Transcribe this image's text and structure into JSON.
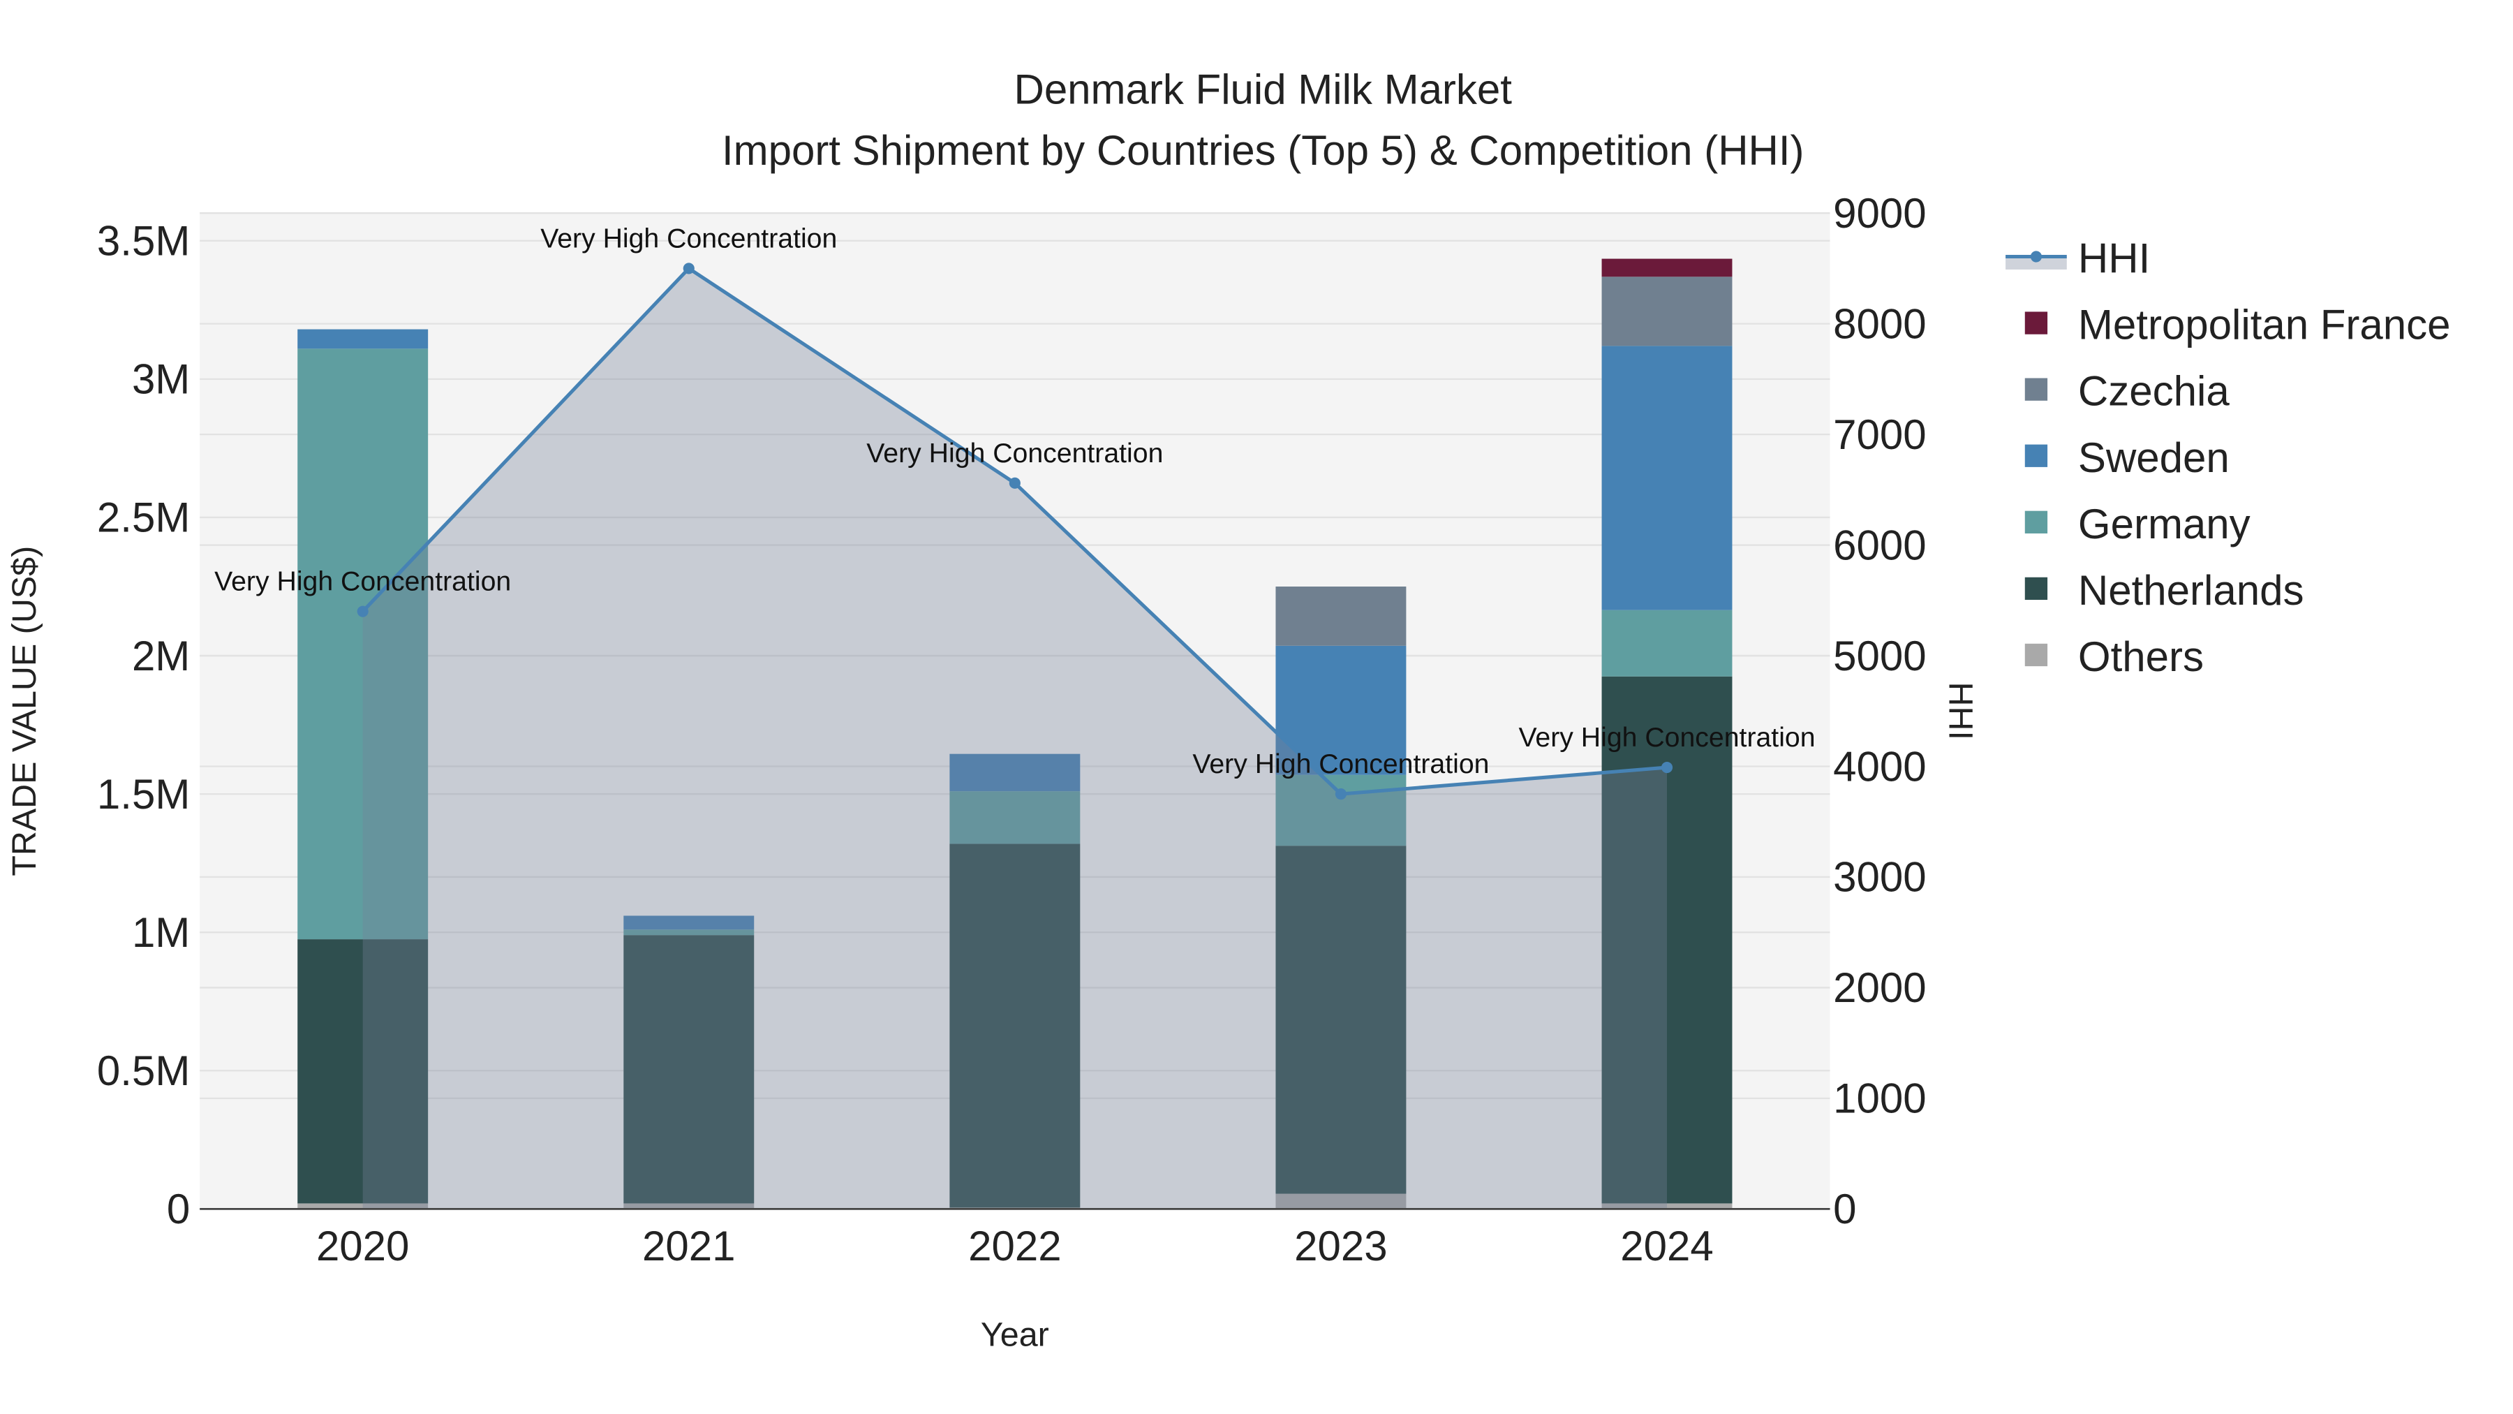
{
  "chart_data": {
    "type": "bar",
    "stacked": true,
    "title": "Denmark Fluid Milk Market",
    "subtitle": "Import Shipment by Countries (Top 5) & Competition (HHI)",
    "xlabel": "Year",
    "ylabel": "TRADE VALUE (US$)",
    "y2label": "HHI",
    "categories": [
      "2020",
      "2021",
      "2022",
      "2023",
      "2024"
    ],
    "ylim": [
      0,
      3600000
    ],
    "y2lim": [
      0,
      9000
    ],
    "yticks": [
      0,
      500000,
      1000000,
      1500000,
      2000000,
      2500000,
      3000000,
      3500000
    ],
    "ytick_labels": [
      "0",
      "0.5M",
      "1M",
      "1.5M",
      "2M",
      "2.5M",
      "3M",
      "3.5M"
    ],
    "y2ticks": [
      0,
      1000,
      2000,
      3000,
      4000,
      5000,
      6000,
      7000,
      8000,
      9000
    ],
    "y2tick_labels": [
      "0",
      "1000",
      "2000",
      "3000",
      "4000",
      "5000",
      "6000",
      "7000",
      "8000",
      "9000"
    ],
    "grid": true,
    "legend_placement": "right",
    "series": [
      {
        "name": "Others",
        "color": "#a9a9a9",
        "values": [
          20000,
          20000,
          5000,
          55000,
          20000
        ]
      },
      {
        "name": "Netherlands",
        "color": "#2f4f4f",
        "values": [
          955000,
          970000,
          1315000,
          1258000,
          1905000
        ]
      },
      {
        "name": "Germany",
        "color": "#5f9ea0",
        "values": [
          2135000,
          20000,
          190000,
          256000,
          240000
        ]
      },
      {
        "name": "Sweden",
        "color": "#4682b4",
        "values": [
          70000,
          50000,
          135000,
          467000,
          955000
        ]
      },
      {
        "name": "Czechia",
        "color": "#708090",
        "values": [
          0,
          0,
          0,
          214000,
          250000
        ]
      },
      {
        "name": "Metropolitan France",
        "color": "#6b1a3a",
        "values": [
          0,
          0,
          0,
          0,
          65000
        ]
      }
    ],
    "hhi": {
      "name": "HHI",
      "color": "#4682b4",
      "values": [
        5400,
        8500,
        6560,
        3750,
        3990
      ],
      "annotations": [
        "Very High Concentration",
        "Very High Concentration",
        "Very High Concentration",
        "Very High Concentration",
        "Very High Concentration"
      ]
    },
    "legend_order": [
      "HHI",
      "Metropolitan France",
      "Czechia",
      "Sweden",
      "Germany",
      "Netherlands",
      "Others"
    ]
  }
}
